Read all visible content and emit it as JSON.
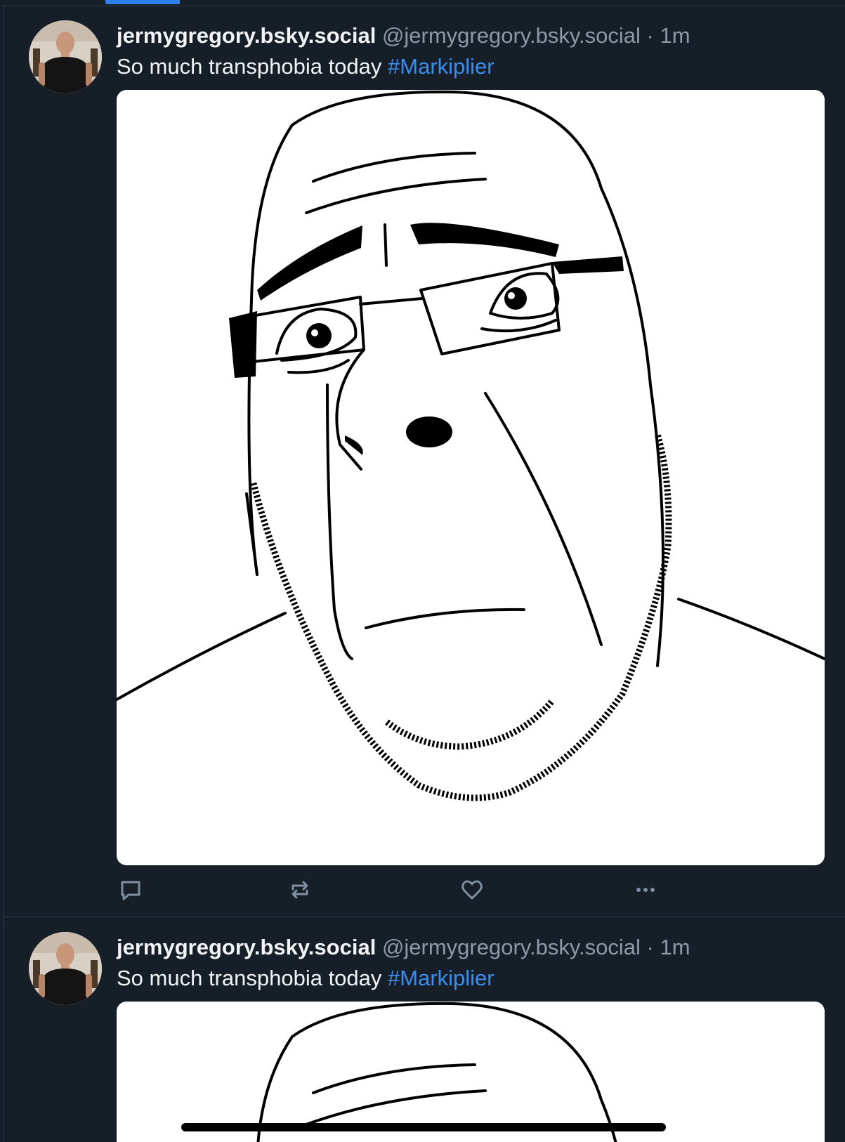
{
  "posts": [
    {
      "display_name": "jermygregory.bsky.social",
      "handle": "@jermygregory.bsky.social",
      "separator": "·",
      "time": "1m",
      "text": "So much transphobia today",
      "hashtag": "#Markiplier"
    },
    {
      "display_name": "jermygregory.bsky.social",
      "handle": "@jermygregory.bsky.social",
      "separator": "·",
      "time": "1m",
      "text": "So much transphobia today",
      "hashtag": "#Markiplier"
    }
  ],
  "icons": {
    "reply": "speech-bubble",
    "repost": "repost-arrows",
    "like": "heart",
    "more": "ellipsis"
  },
  "colors": {
    "background": "#161e27",
    "accent": "#2f80ed",
    "link": "#3b8ef0",
    "text": "#f1f3f5",
    "muted": "#8c9aa8",
    "divider": "#2e3a47"
  }
}
